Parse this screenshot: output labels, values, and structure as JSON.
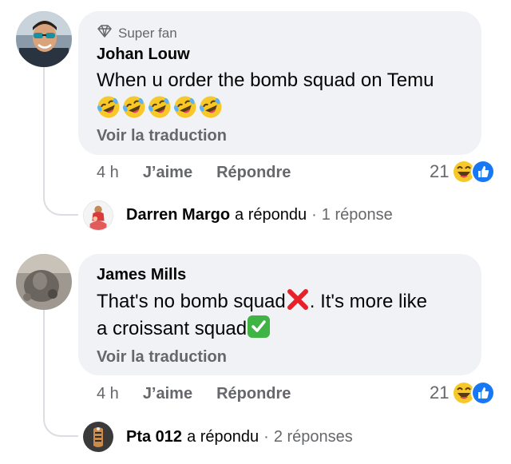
{
  "comments": [
    {
      "badge": "Super fan",
      "author": "Johan Louw",
      "text": "When u order the bomb squad on Temu",
      "emojis": [
        "rofl",
        "rofl",
        "rofl",
        "rofl",
        "rofl"
      ],
      "translate": "Voir la traduction",
      "time": "4 h",
      "like_label": "J’aime",
      "reply_label": "Répondre",
      "reaction_count": "21",
      "reactions": [
        "laugh-icon",
        "like-icon"
      ],
      "replies": {
        "name": "Darren Margo",
        "verb": "a répondu",
        "dot": "·",
        "count": "1 réponse"
      }
    },
    {
      "author": "James Mills",
      "text_part1": "That's no bomb squad",
      "text_part2": ". It's more like",
      "text_line2": "a croissant squad",
      "translate": "Voir la traduction",
      "time": "4 h",
      "like_label": "J’aime",
      "reply_label": "Répondre",
      "reaction_count": "21",
      "reactions": [
        "laugh-icon",
        "like-icon"
      ],
      "replies": {
        "name": "Pta 012",
        "verb": "a répondu",
        "dot": "·",
        "count": "2 réponses"
      }
    }
  ],
  "colors": {
    "bubble": "#f0f2f5",
    "secondary_text": "#65676b",
    "like_blue": "#1877f2",
    "laugh_yellow": "#f7c928",
    "cross_red": "#e8202a",
    "check_green": "#3fb344"
  }
}
